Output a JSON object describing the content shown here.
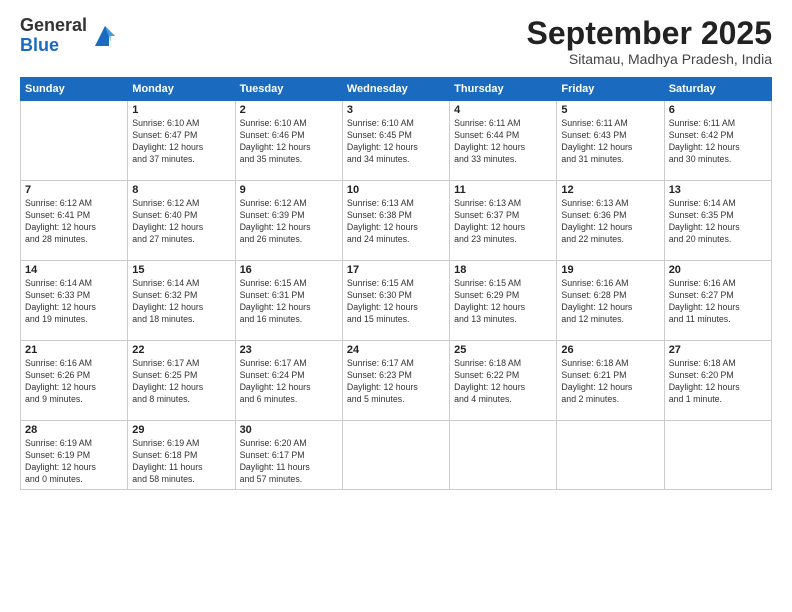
{
  "logo": {
    "general": "General",
    "blue": "Blue"
  },
  "header": {
    "month": "September 2025",
    "location": "Sitamau, Madhya Pradesh, India"
  },
  "weekdays": [
    "Sunday",
    "Monday",
    "Tuesday",
    "Wednesday",
    "Thursday",
    "Friday",
    "Saturday"
  ],
  "weeks": [
    [
      {
        "day": "",
        "info": ""
      },
      {
        "day": "1",
        "info": "Sunrise: 6:10 AM\nSunset: 6:47 PM\nDaylight: 12 hours\nand 37 minutes."
      },
      {
        "day": "2",
        "info": "Sunrise: 6:10 AM\nSunset: 6:46 PM\nDaylight: 12 hours\nand 35 minutes."
      },
      {
        "day": "3",
        "info": "Sunrise: 6:10 AM\nSunset: 6:45 PM\nDaylight: 12 hours\nand 34 minutes."
      },
      {
        "day": "4",
        "info": "Sunrise: 6:11 AM\nSunset: 6:44 PM\nDaylight: 12 hours\nand 33 minutes."
      },
      {
        "day": "5",
        "info": "Sunrise: 6:11 AM\nSunset: 6:43 PM\nDaylight: 12 hours\nand 31 minutes."
      },
      {
        "day": "6",
        "info": "Sunrise: 6:11 AM\nSunset: 6:42 PM\nDaylight: 12 hours\nand 30 minutes."
      }
    ],
    [
      {
        "day": "7",
        "info": "Sunrise: 6:12 AM\nSunset: 6:41 PM\nDaylight: 12 hours\nand 28 minutes."
      },
      {
        "day": "8",
        "info": "Sunrise: 6:12 AM\nSunset: 6:40 PM\nDaylight: 12 hours\nand 27 minutes."
      },
      {
        "day": "9",
        "info": "Sunrise: 6:12 AM\nSunset: 6:39 PM\nDaylight: 12 hours\nand 26 minutes."
      },
      {
        "day": "10",
        "info": "Sunrise: 6:13 AM\nSunset: 6:38 PM\nDaylight: 12 hours\nand 24 minutes."
      },
      {
        "day": "11",
        "info": "Sunrise: 6:13 AM\nSunset: 6:37 PM\nDaylight: 12 hours\nand 23 minutes."
      },
      {
        "day": "12",
        "info": "Sunrise: 6:13 AM\nSunset: 6:36 PM\nDaylight: 12 hours\nand 22 minutes."
      },
      {
        "day": "13",
        "info": "Sunrise: 6:14 AM\nSunset: 6:35 PM\nDaylight: 12 hours\nand 20 minutes."
      }
    ],
    [
      {
        "day": "14",
        "info": "Sunrise: 6:14 AM\nSunset: 6:33 PM\nDaylight: 12 hours\nand 19 minutes."
      },
      {
        "day": "15",
        "info": "Sunrise: 6:14 AM\nSunset: 6:32 PM\nDaylight: 12 hours\nand 18 minutes."
      },
      {
        "day": "16",
        "info": "Sunrise: 6:15 AM\nSunset: 6:31 PM\nDaylight: 12 hours\nand 16 minutes."
      },
      {
        "day": "17",
        "info": "Sunrise: 6:15 AM\nSunset: 6:30 PM\nDaylight: 12 hours\nand 15 minutes."
      },
      {
        "day": "18",
        "info": "Sunrise: 6:15 AM\nSunset: 6:29 PM\nDaylight: 12 hours\nand 13 minutes."
      },
      {
        "day": "19",
        "info": "Sunrise: 6:16 AM\nSunset: 6:28 PM\nDaylight: 12 hours\nand 12 minutes."
      },
      {
        "day": "20",
        "info": "Sunrise: 6:16 AM\nSunset: 6:27 PM\nDaylight: 12 hours\nand 11 minutes."
      }
    ],
    [
      {
        "day": "21",
        "info": "Sunrise: 6:16 AM\nSunset: 6:26 PM\nDaylight: 12 hours\nand 9 minutes."
      },
      {
        "day": "22",
        "info": "Sunrise: 6:17 AM\nSunset: 6:25 PM\nDaylight: 12 hours\nand 8 minutes."
      },
      {
        "day": "23",
        "info": "Sunrise: 6:17 AM\nSunset: 6:24 PM\nDaylight: 12 hours\nand 6 minutes."
      },
      {
        "day": "24",
        "info": "Sunrise: 6:17 AM\nSunset: 6:23 PM\nDaylight: 12 hours\nand 5 minutes."
      },
      {
        "day": "25",
        "info": "Sunrise: 6:18 AM\nSunset: 6:22 PM\nDaylight: 12 hours\nand 4 minutes."
      },
      {
        "day": "26",
        "info": "Sunrise: 6:18 AM\nSunset: 6:21 PM\nDaylight: 12 hours\nand 2 minutes."
      },
      {
        "day": "27",
        "info": "Sunrise: 6:18 AM\nSunset: 6:20 PM\nDaylight: 12 hours\nand 1 minute."
      }
    ],
    [
      {
        "day": "28",
        "info": "Sunrise: 6:19 AM\nSunset: 6:19 PM\nDaylight: 12 hours\nand 0 minutes."
      },
      {
        "day": "29",
        "info": "Sunrise: 6:19 AM\nSunset: 6:18 PM\nDaylight: 11 hours\nand 58 minutes."
      },
      {
        "day": "30",
        "info": "Sunrise: 6:20 AM\nSunset: 6:17 PM\nDaylight: 11 hours\nand 57 minutes."
      },
      {
        "day": "",
        "info": ""
      },
      {
        "day": "",
        "info": ""
      },
      {
        "day": "",
        "info": ""
      },
      {
        "day": "",
        "info": ""
      }
    ]
  ]
}
